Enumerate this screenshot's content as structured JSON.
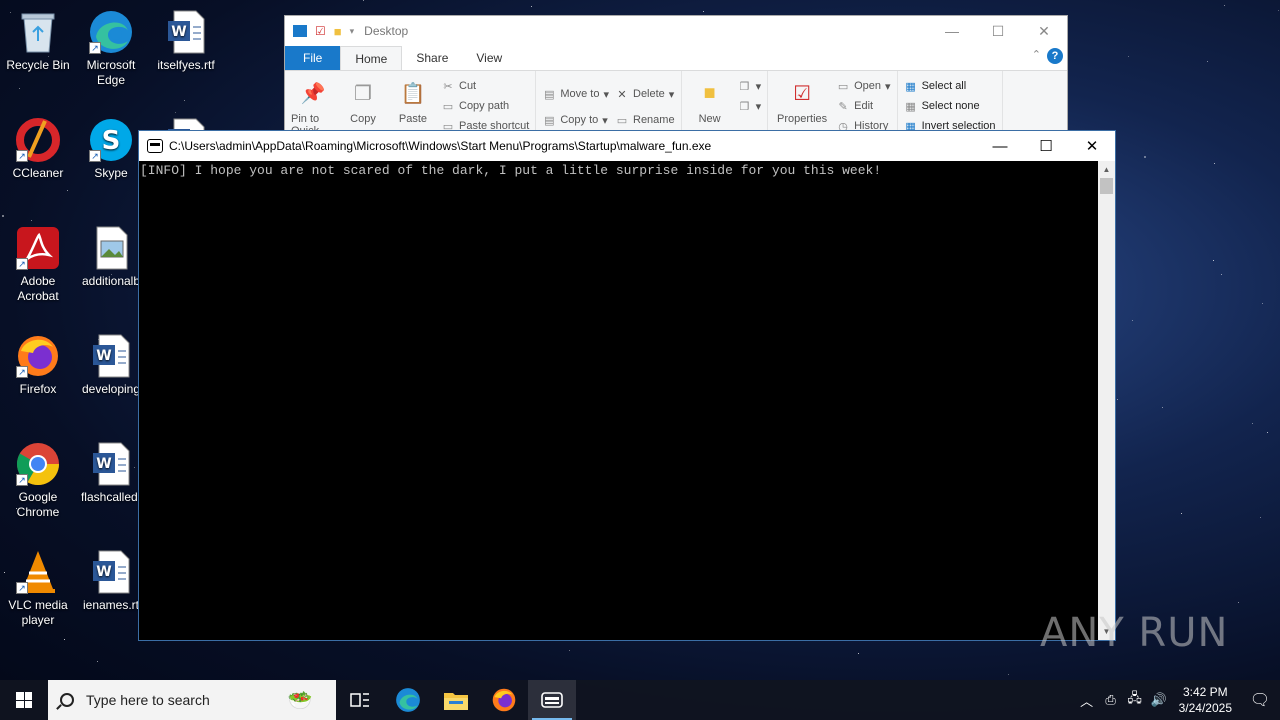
{
  "desktop": {
    "icons": [
      {
        "label": "Recycle Bin",
        "icon": "recycle-bin-icon"
      },
      {
        "label": "Microsoft\nEdge",
        "icon": "edge-icon"
      },
      {
        "label": "itselfyes.rtf",
        "icon": "word-doc-icon"
      },
      {
        "label": "CCleaner",
        "icon": "ccleaner-icon"
      },
      {
        "label": "Skype",
        "icon": "skype-icon"
      },
      {
        "label": "Adobe\nAcrobat",
        "icon": "acrobat-icon"
      },
      {
        "label": "additionalb",
        "icon": "image-file-icon"
      },
      {
        "label": "Firefox",
        "icon": "firefox-icon"
      },
      {
        "label": "developing",
        "icon": "word-doc-icon"
      },
      {
        "label": "Google\nChrome",
        "icon": "chrome-icon"
      },
      {
        "label": "flashcalled.",
        "icon": "word-doc-icon"
      },
      {
        "label": "VLC media\nplayer",
        "icon": "vlc-icon"
      },
      {
        "label": "ienames.rt",
        "icon": "word-doc-icon"
      }
    ]
  },
  "explorer": {
    "title": "Desktop",
    "tabs": [
      "File",
      "Home",
      "Share",
      "View"
    ],
    "ribbon": {
      "pin": "Pin to Quick",
      "copy": "Copy",
      "paste": "Paste",
      "cut": "Cut",
      "copy_path": "Copy path",
      "paste_shortcut": "Paste shortcut",
      "move_to": "Move to",
      "copy_to": "Copy to",
      "delete": "Delete",
      "rename": "Rename",
      "new_folder": "New",
      "properties": "Properties",
      "open": "Open",
      "edit": "Edit",
      "history": "History",
      "select_all": "Select all",
      "select_none": "Select none",
      "invert_selection": "Invert selection"
    }
  },
  "console": {
    "title": "C:\\Users\\admin\\AppData\\Roaming\\Microsoft\\Windows\\Start Menu\\Programs\\Startup\\malware_fun.exe",
    "output": "[INFO] I hope you are not scared of the dark, I put a little surprise inside for you this week!"
  },
  "watermark": "ANY RUN",
  "taskbar": {
    "search_placeholder": "Type here to search",
    "apps": [
      "task-view-icon",
      "edge-icon",
      "file-explorer-icon",
      "firefox-icon",
      "console-app-icon"
    ],
    "time": "3:42 PM",
    "date": "3/24/2025"
  },
  "colors": {
    "accent": "#1979ca",
    "console_bg": "#000000",
    "console_text": "#c0c0c0"
  }
}
